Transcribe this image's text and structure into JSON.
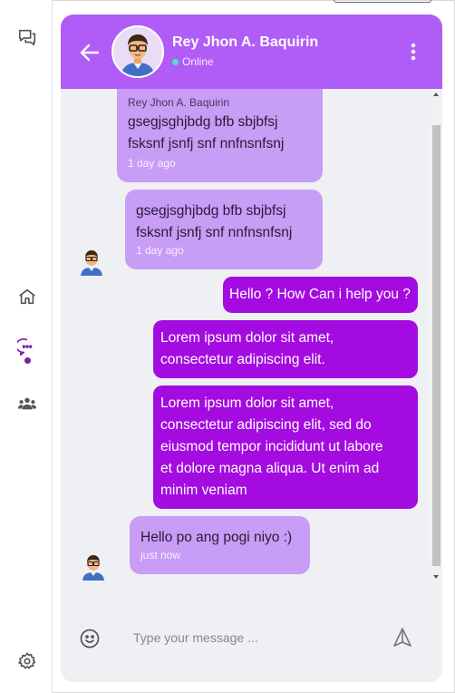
{
  "header": {
    "contact_name": "Rey Jhon A. Baquirin",
    "status": "Online"
  },
  "nav": {
    "items": [
      {
        "icon": "chat-bubbles-icon"
      },
      {
        "icon": "home-icon"
      },
      {
        "icon": "chat-icon",
        "active": true
      },
      {
        "icon": "users-icon"
      },
      {
        "icon": "settings-icon"
      }
    ]
  },
  "messages": [
    {
      "direction": "in",
      "sender": "Rey Jhon A. Baquirin",
      "lines": [
        "gsegjsghjbdg bfb sbjbfsj",
        "fsksnf jsnfj snf nnfnsnfsnj"
      ],
      "time": "1 day ago"
    },
    {
      "direction": "in",
      "lines": [
        "gsegjsghjbdg bfb sbjbfsj",
        "fsksnf jsnfj snf nnfnsnfsnj"
      ],
      "time": "1 day ago"
    },
    {
      "direction": "out",
      "lines": [
        "Hello ? How Can i help you ?"
      ]
    },
    {
      "direction": "out",
      "lines": [
        "Lorem ipsum dolor sit amet,",
        "consectetur adipiscing elit."
      ]
    },
    {
      "direction": "out",
      "lines": [
        "Lorem ipsum dolor sit amet,",
        "consectetur adipiscing elit, sed do",
        "eiusmod tempor incididunt ut labore",
        "et dolore magna aliqua. Ut enim ad",
        "minim veniam"
      ]
    },
    {
      "direction": "in",
      "lines": [
        "Hello po ang pogi niyo :)"
      ],
      "time": "just now"
    }
  ],
  "composer": {
    "placeholder": "Type your message ..."
  },
  "colors": {
    "header": "#b05cf6",
    "incoming_bubble": "#c79df5",
    "outgoing_bubble": "#a40be0",
    "online": "#4ce3c3"
  }
}
